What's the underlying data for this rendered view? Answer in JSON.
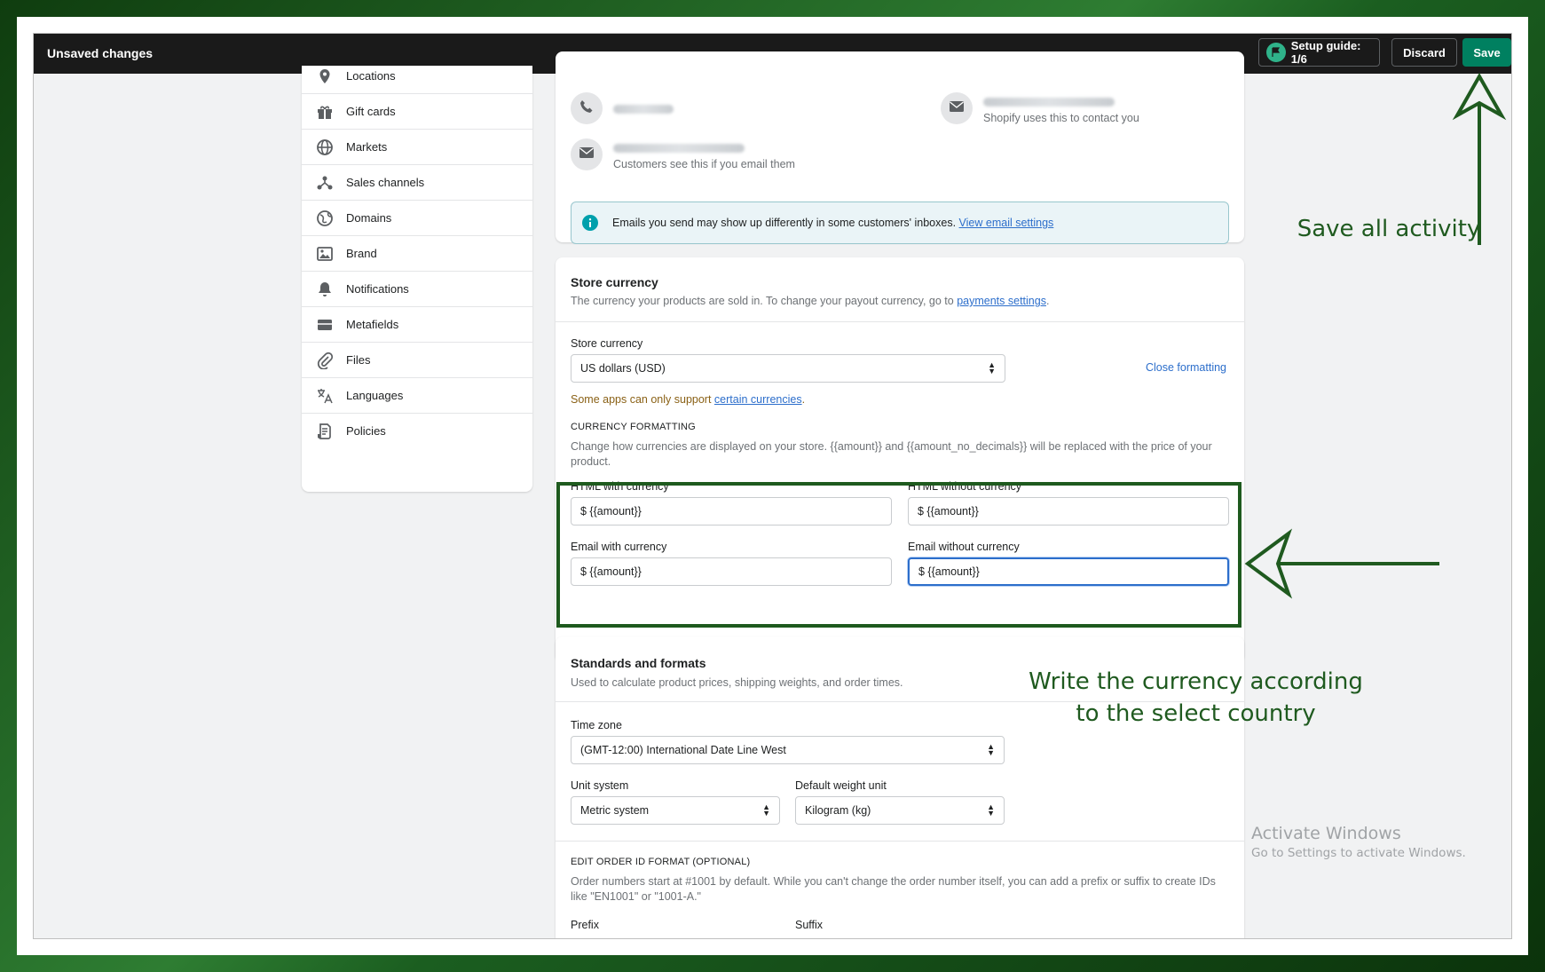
{
  "topbar": {
    "title": "Unsaved changes",
    "setup_guide": "Setup guide: 1/6",
    "discard": "Discard",
    "save": "Save"
  },
  "sidebar": {
    "items": [
      {
        "label": "Locations",
        "icon": "location-pin-icon"
      },
      {
        "label": "Gift cards",
        "icon": "gift-icon"
      },
      {
        "label": "Markets",
        "icon": "globe-icon"
      },
      {
        "label": "Sales channels",
        "icon": "channels-icon"
      },
      {
        "label": "Domains",
        "icon": "domains-globe-icon"
      },
      {
        "label": "Brand",
        "icon": "brand-icon"
      },
      {
        "label": "Notifications",
        "icon": "bell-icon"
      },
      {
        "label": "Metafields",
        "icon": "metafields-icon"
      },
      {
        "label": "Files",
        "icon": "paperclip-icon"
      },
      {
        "label": "Languages",
        "icon": "translate-icon"
      },
      {
        "label": "Policies",
        "icon": "document-icon"
      }
    ]
  },
  "contact": {
    "sender_hint": "Shopify uses this to contact you",
    "customer_hint": "Customers see this if you email them",
    "banner_text": "Emails you send may show up differently in some customers' inboxes.",
    "banner_link": "View email settings"
  },
  "store_currency": {
    "heading": "Store currency",
    "description": "The currency your products are sold in. To change your payout currency, go to",
    "description_link": "payments settings",
    "description_end": ".",
    "field_label": "Store currency",
    "selected": "US dollars (USD)",
    "close_formatting": "Close formatting",
    "warning_text": "Some apps can only support",
    "warning_link": "certain currencies",
    "warning_end": ".",
    "formatting_caps": "CURRENCY FORMATTING",
    "formatting_desc": "Change how currencies are displayed on your store. {{amount}} and {{amount_no_decimals}} will be replaced with the price of your product.",
    "fields": {
      "html_with_label": "HTML with currency",
      "html_with_value": "$ {{amount}}",
      "html_without_label": "HTML without currency",
      "html_without_value": "$ {{amount}}",
      "email_with_label": "Email with currency",
      "email_with_value": "$ {{amount}}",
      "email_without_label": "Email without currency",
      "email_without_value": "$ {{amount}}"
    }
  },
  "standards": {
    "heading": "Standards and formats",
    "description": "Used to calculate product prices, shipping weights, and order times.",
    "timezone_label": "Time zone",
    "timezone_value": "(GMT-12:00) International Date Line West",
    "unit_label": "Unit system",
    "unit_value": "Metric system",
    "weight_label": "Default weight unit",
    "weight_value": "Kilogram (kg)",
    "order_caps": "EDIT ORDER ID FORMAT (OPTIONAL)",
    "order_desc": "Order numbers start at #1001 by default. While you can't change the order number itself, you can add a prefix or suffix to create IDs like \"EN1001\" or \"1001-A.\"",
    "prefix_label": "Prefix",
    "suffix_label": "Suffix"
  },
  "annotations": {
    "save_note": "Save all activity",
    "currency_note_line1": "Write the currency according",
    "currency_note_line2": "to the select country",
    "color": "#1f5a1f"
  },
  "watermark": {
    "line1": "Activate Windows",
    "line2": "Go to Settings to activate Windows."
  }
}
